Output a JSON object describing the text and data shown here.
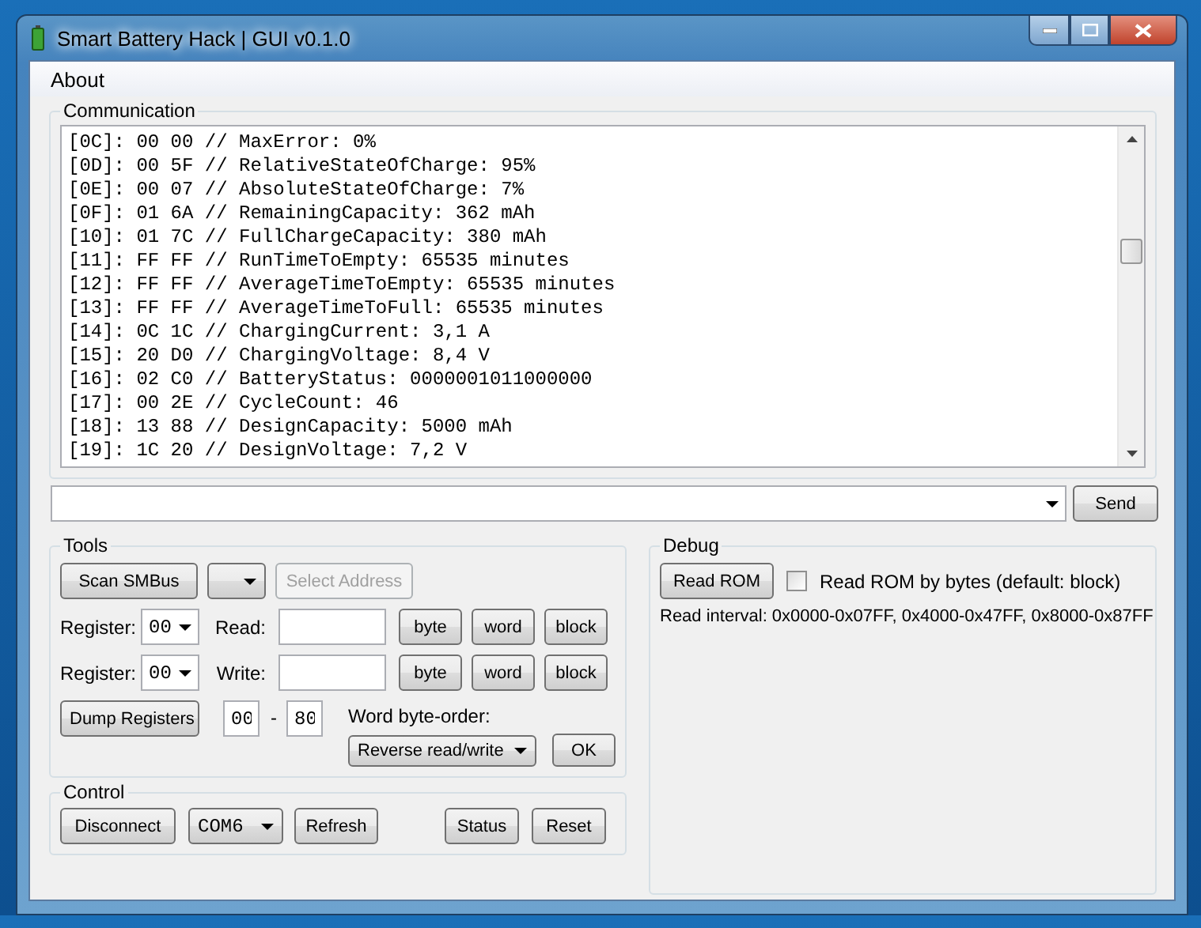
{
  "window": {
    "title": "Smart Battery Hack  |  GUI v0.1.0"
  },
  "menu": [
    {
      "label": "About"
    }
  ],
  "communication": {
    "title": "Communication",
    "log": [
      "[0C]: 00 00 // MaxError: 0%",
      "[0D]: 00 5F // RelativeStateOfCharge: 95%",
      "[0E]: 00 07 // AbsoluteStateOfCharge: 7%",
      "[0F]: 01 6A // RemainingCapacity: 362 mAh",
      "[10]: 01 7C // FullChargeCapacity: 380 mAh",
      "[11]: FF FF // RunTimeToEmpty: 65535 minutes",
      "[12]: FF FF // AverageTimeToEmpty: 65535 minutes",
      "[13]: FF FF // AverageTimeToFull: 65535 minutes",
      "[14]: 0C 1C // ChargingCurrent: 3,1 A",
      "[15]: 20 D0 // ChargingVoltage: 8,4 V",
      "[16]: 02 C0 // BatteryStatus: 0000001011000000",
      "[17]: 00 2E // CycleCount: 46",
      "[18]: 13 88 // DesignCapacity: 5000 mAh",
      "[19]: 1C 20 // DesignVoltage: 7,2 V"
    ],
    "send_button": "Send"
  },
  "tools": {
    "title": "Tools",
    "scan_button": "Scan SMBus",
    "select_address": {
      "label": "Select Address",
      "disabled": true
    },
    "rows": [
      {
        "label": "Register:",
        "register": "00",
        "op_label": "Read:",
        "buttons": [
          "byte",
          "word",
          "block"
        ]
      },
      {
        "label": "Register:",
        "register": "00",
        "op_label": "Write:",
        "buttons": [
          "byte",
          "word",
          "block"
        ]
      }
    ],
    "dump_button": "Dump Registers",
    "range_from": "00",
    "range_sep": "-",
    "range_to": "80",
    "byte_order_label": "Word byte-order:",
    "byte_order": "Reverse read/write",
    "ok_button": "OK"
  },
  "debug": {
    "title": "Debug",
    "read_rom_button": "Read ROM",
    "by_bytes": {
      "label": "Read ROM by bytes (default: block)",
      "checked": false
    },
    "interval": "Read interval: 0x0000-0x07FF, 0x4000-0x47FF, 0x8000-0x87FF"
  },
  "control": {
    "title": "Control",
    "disconnect_button": "Disconnect",
    "port": "COM6",
    "refresh_button": "Refresh",
    "status_button": "Status",
    "reset_button": "Reset"
  }
}
